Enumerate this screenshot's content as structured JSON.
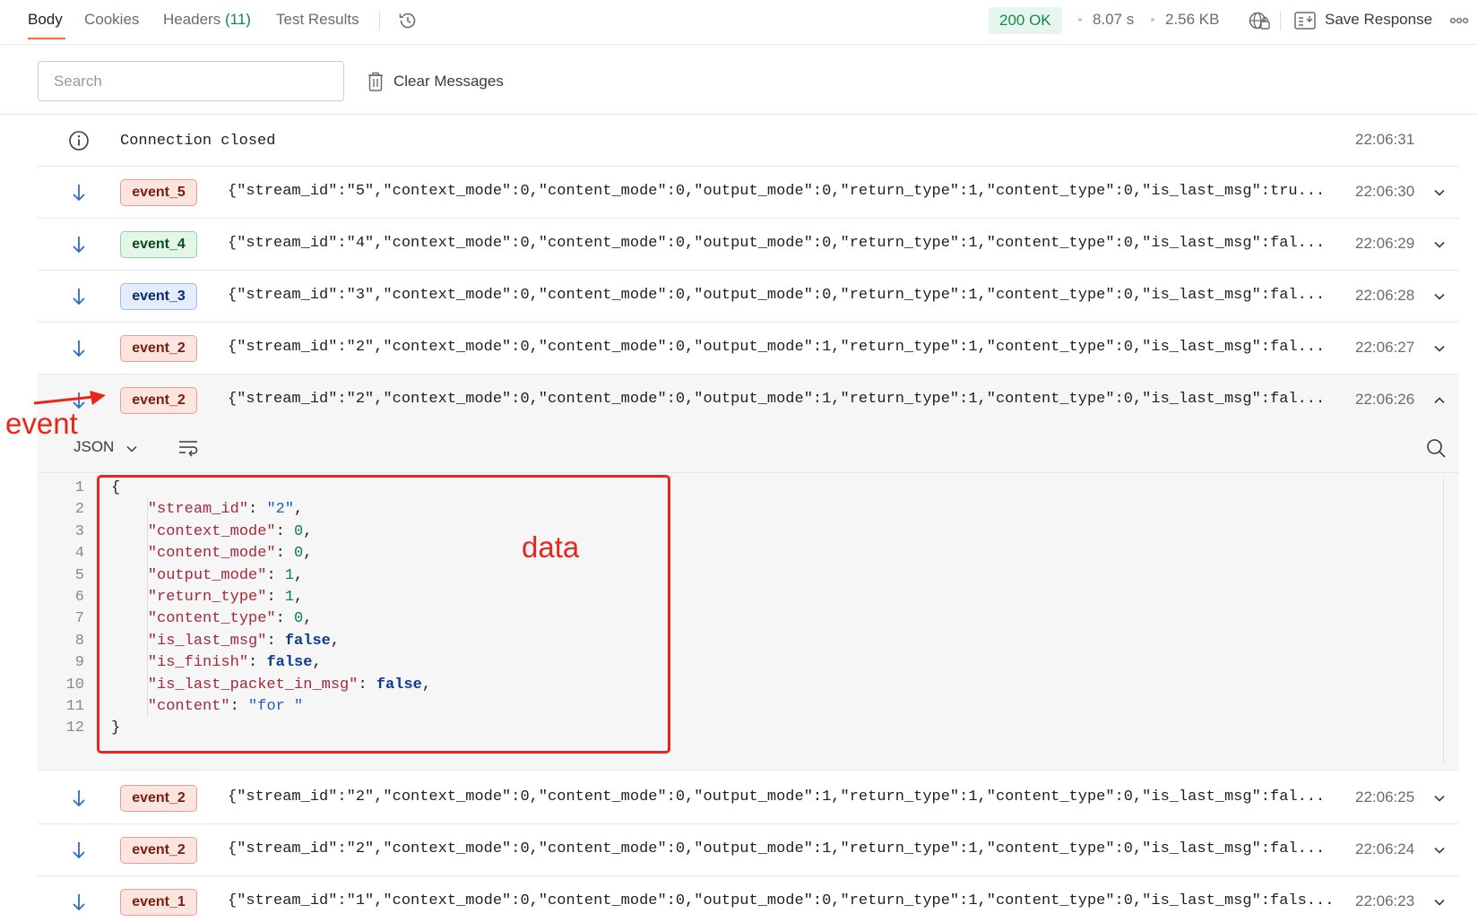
{
  "tabs": [
    {
      "label": "Body"
    },
    {
      "label": "Cookies"
    },
    {
      "label": "Headers",
      "count": "(11)"
    },
    {
      "label": "Test Results"
    }
  ],
  "response_meta": {
    "status": "200 OK",
    "time": "8.07 s",
    "size": "2.56 KB",
    "save_label": "Save Response"
  },
  "toolbar": {
    "search_placeholder": "Search",
    "clear_label": "Clear Messages"
  },
  "messages": [
    {
      "type": "info",
      "text": "Connection closed",
      "time": "22:06:31"
    },
    {
      "type": "event",
      "event": "event_5",
      "badge_color": "red",
      "payload": "{\"stream_id\":\"5\",\"context_mode\":0,\"content_mode\":0,\"output_mode\":0,\"return_type\":1,\"content_type\":0,\"is_last_msg\":tru...",
      "time": "22:06:30",
      "expanded": false
    },
    {
      "type": "event",
      "event": "event_4",
      "badge_color": "green",
      "payload": "{\"stream_id\":\"4\",\"context_mode\":0,\"content_mode\":0,\"output_mode\":0,\"return_type\":1,\"content_type\":0,\"is_last_msg\":fal...",
      "time": "22:06:29",
      "expanded": false
    },
    {
      "type": "event",
      "event": "event_3",
      "badge_color": "blue",
      "payload": "{\"stream_id\":\"3\",\"context_mode\":0,\"content_mode\":0,\"output_mode\":0,\"return_type\":1,\"content_type\":0,\"is_last_msg\":fal...",
      "time": "22:06:28",
      "expanded": false
    },
    {
      "type": "event",
      "event": "event_2",
      "badge_color": "red",
      "payload": "{\"stream_id\":\"2\",\"context_mode\":0,\"content_mode\":0,\"output_mode\":1,\"return_type\":1,\"content_type\":0,\"is_last_msg\":fal...",
      "time": "22:06:27",
      "expanded": false
    },
    {
      "type": "event",
      "event": "event_2",
      "badge_color": "red",
      "payload": "{\"stream_id\":\"2\",\"context_mode\":0,\"content_mode\":0,\"output_mode\":1,\"return_type\":1,\"content_type\":0,\"is_last_msg\":fal...",
      "time": "22:06:26",
      "expanded": true
    },
    {
      "type": "event",
      "event": "event_2",
      "badge_color": "red",
      "payload": "{\"stream_id\":\"2\",\"context_mode\":0,\"content_mode\":0,\"output_mode\":1,\"return_type\":1,\"content_type\":0,\"is_last_msg\":fal...",
      "time": "22:06:25",
      "expanded": false
    },
    {
      "type": "event",
      "event": "event_2",
      "badge_color": "red",
      "payload": "{\"stream_id\":\"2\",\"context_mode\":0,\"content_mode\":0,\"output_mode\":1,\"return_type\":1,\"content_type\":0,\"is_last_msg\":fal...",
      "time": "22:06:24",
      "expanded": false
    },
    {
      "type": "event",
      "event": "event_1",
      "badge_color": "red",
      "payload": "{\"stream_id\":\"1\",\"context_mode\":0,\"content_mode\":0,\"output_mode\":0,\"return_type\":1,\"content_type\":0,\"is_last_msg\":fals...",
      "time": "22:06:23",
      "expanded": false
    }
  ],
  "detail": {
    "format": "JSON",
    "lines": [
      {
        "num": "1",
        "tokens": [
          {
            "t": "p",
            "v": "{"
          }
        ]
      },
      {
        "num": "2",
        "tokens": [
          {
            "t": "k",
            "v": "\"stream_id\""
          },
          {
            "t": "p",
            "v": ": "
          },
          {
            "t": "s",
            "v": "\"2\""
          },
          {
            "t": "p",
            "v": ","
          }
        ]
      },
      {
        "num": "3",
        "tokens": [
          {
            "t": "k",
            "v": "\"context_mode\""
          },
          {
            "t": "p",
            "v": ": "
          },
          {
            "t": "n",
            "v": "0"
          },
          {
            "t": "p",
            "v": ","
          }
        ]
      },
      {
        "num": "4",
        "tokens": [
          {
            "t": "k",
            "v": "\"content_mode\""
          },
          {
            "t": "p",
            "v": ": "
          },
          {
            "t": "n",
            "v": "0"
          },
          {
            "t": "p",
            "v": ","
          }
        ]
      },
      {
        "num": "5",
        "tokens": [
          {
            "t": "k",
            "v": "\"output_mode\""
          },
          {
            "t": "p",
            "v": ": "
          },
          {
            "t": "n",
            "v": "1"
          },
          {
            "t": "p",
            "v": ","
          }
        ]
      },
      {
        "num": "6",
        "tokens": [
          {
            "t": "k",
            "v": "\"return_type\""
          },
          {
            "t": "p",
            "v": ": "
          },
          {
            "t": "n",
            "v": "1"
          },
          {
            "t": "p",
            "v": ","
          }
        ]
      },
      {
        "num": "7",
        "tokens": [
          {
            "t": "k",
            "v": "\"content_type\""
          },
          {
            "t": "p",
            "v": ": "
          },
          {
            "t": "n",
            "v": "0"
          },
          {
            "t": "p",
            "v": ","
          }
        ]
      },
      {
        "num": "8",
        "tokens": [
          {
            "t": "k",
            "v": "\"is_last_msg\""
          },
          {
            "t": "p",
            "v": ": "
          },
          {
            "t": "b",
            "v": "false"
          },
          {
            "t": "p",
            "v": ","
          }
        ]
      },
      {
        "num": "9",
        "tokens": [
          {
            "t": "k",
            "v": "\"is_finish\""
          },
          {
            "t": "p",
            "v": ": "
          },
          {
            "t": "b",
            "v": "false"
          },
          {
            "t": "p",
            "v": ","
          }
        ]
      },
      {
        "num": "10",
        "tokens": [
          {
            "t": "k",
            "v": "\"is_last_packet_in_msg\""
          },
          {
            "t": "p",
            "v": ": "
          },
          {
            "t": "b",
            "v": "false"
          },
          {
            "t": "p",
            "v": ","
          }
        ]
      },
      {
        "num": "11",
        "tokens": [
          {
            "t": "k",
            "v": "\"content\""
          },
          {
            "t": "p",
            "v": ": "
          },
          {
            "t": "s",
            "v": "\"for \""
          }
        ]
      },
      {
        "num": "12",
        "tokens": [
          {
            "t": "p",
            "v": "}"
          }
        ]
      }
    ]
  },
  "annotations": {
    "event_label": "event",
    "data_label": "data",
    "color": "#e8261b"
  },
  "colors": {
    "accent": "#ff6c37",
    "status_ok": "#0f8a4a"
  },
  "icons": [
    "history-icon",
    "globe-icon",
    "save-icon",
    "more-icon",
    "trash-icon",
    "info-icon",
    "arrow-down-icon",
    "chevron-down-icon",
    "chevron-up-icon",
    "wrap-icon",
    "search-icon"
  ]
}
